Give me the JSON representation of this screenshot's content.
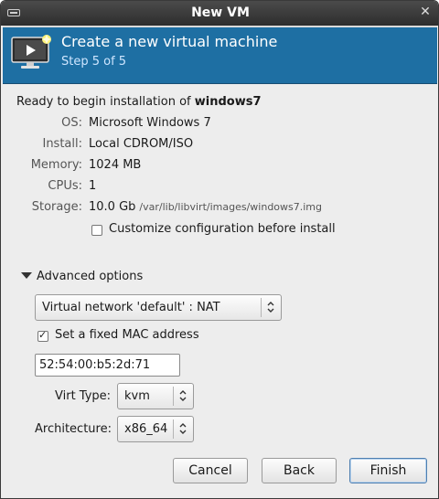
{
  "window": {
    "title": "New VM"
  },
  "banner": {
    "title": "Create a new virtual machine",
    "step": "Step 5 of 5"
  },
  "summary": {
    "ready_prefix": "Ready to begin installation of ",
    "vm_name": "windows7",
    "rows": [
      {
        "label": "OS:",
        "value": "Microsoft Windows 7"
      },
      {
        "label": "Install:",
        "value": "Local CDROM/ISO"
      },
      {
        "label": "Memory:",
        "value": "1024 MB"
      },
      {
        "label": "CPUs:",
        "value": "1"
      },
      {
        "label": "Storage:",
        "value": "10.0 Gb",
        "path": "/var/lib/libvirt/images/windows7.img"
      }
    ],
    "customize_label": "Customize configuration before install",
    "customize_checked": false
  },
  "advanced": {
    "expander_label": "Advanced options",
    "network_value": "Virtual network 'default' : NAT",
    "fixed_mac_label": "Set a fixed MAC address",
    "fixed_mac_checked": true,
    "mac_value": "52:54:00:b5:2d:71",
    "virt_type_label": "Virt Type:",
    "virt_type_value": "kvm",
    "arch_label": "Architecture:",
    "arch_value": "x86_64"
  },
  "buttons": {
    "cancel": "Cancel",
    "back": "Back",
    "finish": "Finish"
  }
}
